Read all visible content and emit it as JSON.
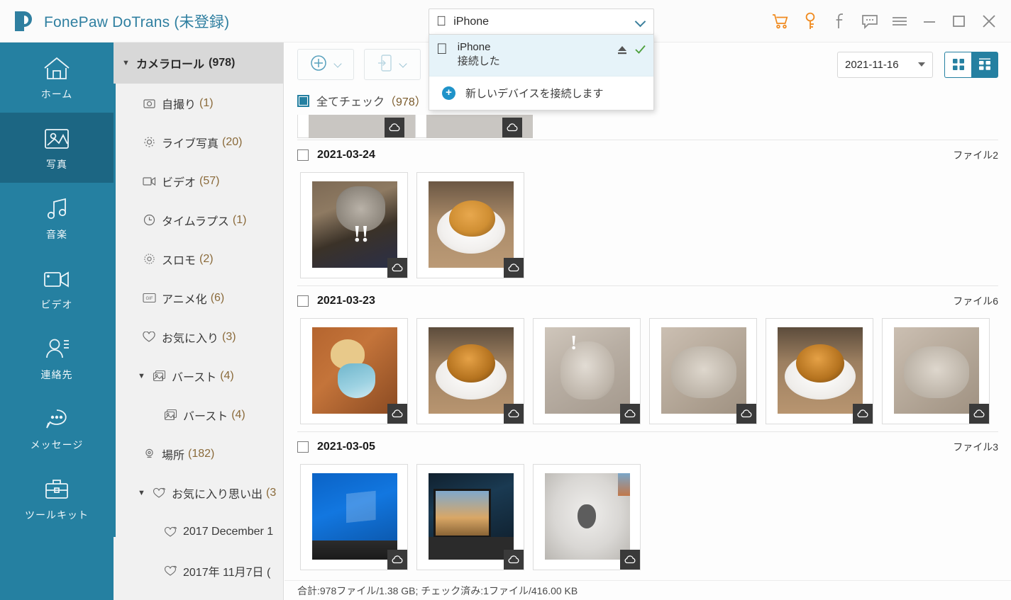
{
  "app": {
    "title": "FonePaw DoTrans",
    "title_suffix": "(未登録)"
  },
  "titlebar_icons": [
    {
      "name": "cart-icon",
      "label": "カート"
    },
    {
      "name": "key-icon",
      "label": "キー"
    },
    {
      "name": "facebook-icon",
      "label": "f"
    },
    {
      "name": "feedback-icon",
      "label": "フィードバック"
    },
    {
      "name": "menu-icon",
      "label": "メニュー"
    },
    {
      "name": "minimize-icon",
      "label": "最小化"
    },
    {
      "name": "maximize-icon",
      "label": "最大化"
    },
    {
      "name": "close-icon",
      "label": "閉じる"
    }
  ],
  "device": {
    "selected": "iPhone",
    "dropdown_open": true,
    "items": [
      {
        "name": "iPhone",
        "status": "接続した",
        "connected": true
      },
      {
        "name": "新しいデバイスを接続します",
        "status": "",
        "connected": false
      }
    ]
  },
  "sidebar": {
    "items": [
      {
        "label": "ホーム",
        "icon": "home-icon",
        "selected": false
      },
      {
        "label": "写真",
        "icon": "photo-icon",
        "selected": true
      },
      {
        "label": "音楽",
        "icon": "music-icon",
        "selected": false
      },
      {
        "label": "ビデオ",
        "icon": "video-icon",
        "selected": false
      },
      {
        "label": "連絡先",
        "icon": "contacts-icon",
        "selected": false
      },
      {
        "label": "メッセージ",
        "icon": "message-icon",
        "selected": false
      },
      {
        "label": "ツールキット",
        "icon": "toolkit-icon",
        "selected": false
      }
    ]
  },
  "tree": {
    "root": {
      "label": "カメラロール",
      "count": "(978)",
      "expanded": true
    },
    "items": [
      {
        "label": "自撮り",
        "count": "(1)",
        "icon": "camera-icon",
        "indent": 1,
        "caret": false
      },
      {
        "label": "ライブ写真",
        "count": "(20)",
        "icon": "live-icon",
        "indent": 1,
        "caret": false
      },
      {
        "label": "ビデオ",
        "count": "(57)",
        "icon": "video-small-icon",
        "indent": 1,
        "caret": false
      },
      {
        "label": "タイムラプス",
        "count": "(1)",
        "icon": "clock-icon",
        "indent": 1,
        "caret": false
      },
      {
        "label": "スロモ",
        "count": "(2)",
        "icon": "slomo-icon",
        "indent": 1,
        "caret": false
      },
      {
        "label": "アニメ化",
        "count": "(6)",
        "icon": "gif-icon",
        "indent": 1,
        "caret": false
      },
      {
        "label": "お気に入り",
        "count": "(3)",
        "icon": "heart-icon",
        "indent": 1,
        "caret": false
      },
      {
        "label": "バースト",
        "count": "(4)",
        "icon": "burst-icon",
        "indent": 0,
        "caret": true
      },
      {
        "label": "バースト",
        "count": "(4)",
        "icon": "burst-icon",
        "indent": 2,
        "caret": false
      },
      {
        "label": "場所",
        "count": "(182)",
        "icon": "location-icon",
        "indent": 1,
        "caret": false
      },
      {
        "label": "お気に入り思い出",
        "count": "(3",
        "icon": "hearts-icon",
        "indent": 0,
        "caret": true
      },
      {
        "label": "2017 December 1",
        "count": "",
        "icon": "hearts-icon",
        "indent": 2,
        "caret": false
      },
      {
        "label": "2017年 11月7日 (",
        "count": "",
        "icon": "hearts-icon",
        "indent": 2,
        "caret": false
      }
    ]
  },
  "toolbar": {
    "add_button": "add-icon",
    "export_button": "export-device-icon",
    "third_button": "delete-icon",
    "date_filter": "2021-11-16",
    "view_grid_label": "grid-view",
    "view_list_label": "list-view"
  },
  "check_all": {
    "label": "全てチェック",
    "count": "（978）",
    "checked": true
  },
  "groups": [
    {
      "date": "2021-03-24",
      "file_count": "ファイル2",
      "checked": false,
      "thumbs": [
        {
          "art": "ph-cat1",
          "badge": "cloud-icon"
        },
        {
          "art": "ph-bun",
          "badge": "cloud-icon"
        }
      ]
    },
    {
      "date": "2021-03-23",
      "file_count": "ファイル6",
      "checked": false,
      "thumbs": [
        {
          "art": "ph-cartoon",
          "badge": "cloud-icon"
        },
        {
          "art": "ph-bun2",
          "badge": "cloud-icon"
        },
        {
          "art": "ph-cat2",
          "badge": "cloud-icon"
        },
        {
          "art": "ph-cat3",
          "badge": "cloud-icon"
        },
        {
          "art": "ph-bun2",
          "badge": "cloud-icon"
        },
        {
          "art": "ph-cat3",
          "badge": "cloud-icon"
        }
      ]
    },
    {
      "date": "2021-03-05",
      "file_count": "ファイル3",
      "checked": false,
      "thumbs": [
        {
          "art": "ph-win",
          "badge": "cloud-icon"
        },
        {
          "art": "ph-desk",
          "badge": "cloud-icon"
        },
        {
          "art": "ph-apple",
          "badge": "cloud-icon"
        }
      ]
    }
  ],
  "status_bar": {
    "text": "合計:978ファイル/1.38 GB; チェック済み:1ファイル/416.00 KB"
  },
  "colors": {
    "sidebar": "#2580a1",
    "sidebar_selected": "#1c6683",
    "accent": "#2580a1",
    "title_text": "#2f7fa0",
    "count_text": "#8a6a3a",
    "orange_icon": "#f08a1e"
  }
}
